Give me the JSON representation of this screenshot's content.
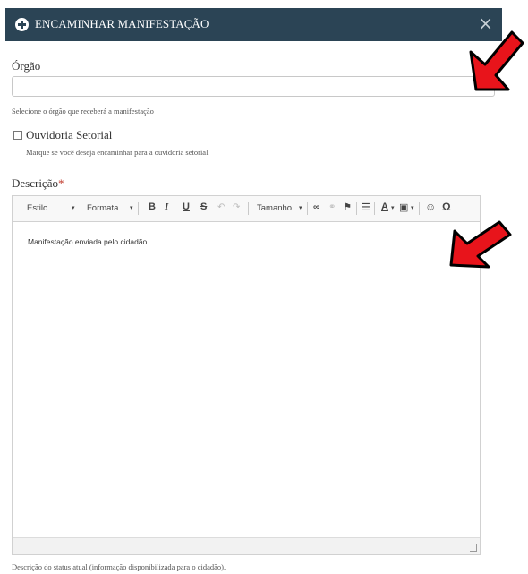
{
  "modal": {
    "title": "ENCAMINHAR MANIFESTAÇÃO",
    "close_symbol": "×"
  },
  "orgao": {
    "label": "Órgão",
    "value": "",
    "help": "Selecione o órgão que receberá a manifestação"
  },
  "ouvidoria": {
    "label": "Ouvidoria Setorial",
    "checked": false,
    "help": "Marque se você deseja encaminhar para a ouvidoria setorial."
  },
  "descricao": {
    "label": "Descrição",
    "required_mark": "*",
    "content": "Manifestação enviada pelo cidadão.",
    "help": "Descrição do status atual (informação disponibilizada para o cidadão)."
  },
  "toolbar": {
    "style": "Estilo",
    "format": "Formata...",
    "bold": "B",
    "italic": "I",
    "underline": "U",
    "strike": "S",
    "undo": "↶",
    "redo": "↷",
    "size": "Tamanho",
    "link": "∞",
    "unlink": "⚭",
    "anchor": "⚑",
    "hr": "☰",
    "text_color": "A",
    "bg_color": "▣",
    "emoji": "☺",
    "special_char": "Ω"
  },
  "icons": {
    "header_icon": "plus-circle-icon",
    "annotation_color": "#e8141b"
  }
}
